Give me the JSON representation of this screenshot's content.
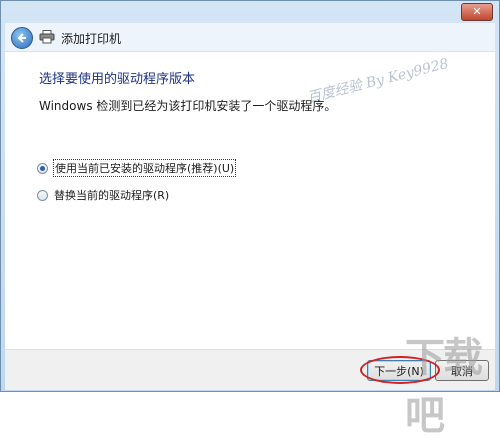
{
  "window": {
    "title": "添加打印机",
    "close_label": "✕"
  },
  "page": {
    "heading": "选择要使用的驱动程序版本",
    "description": "Windows 检测到已经为该打印机安装了一个驱动程序。"
  },
  "options": [
    {
      "label": "使用当前已安装的驱动程序(推荐)(U)",
      "checked": true
    },
    {
      "label": "替换当前的驱动程序(R)",
      "checked": false
    }
  ],
  "footer": {
    "next_label": "下一步(N)",
    "cancel_label": "取消"
  },
  "watermark": "百度经验 By Key9928",
  "logo": "下载吧",
  "colors": {
    "heading": "#1e3287",
    "annotation": "#d32020"
  },
  "icons": [
    "back-arrow-icon",
    "printer-icon",
    "close-icon"
  ]
}
